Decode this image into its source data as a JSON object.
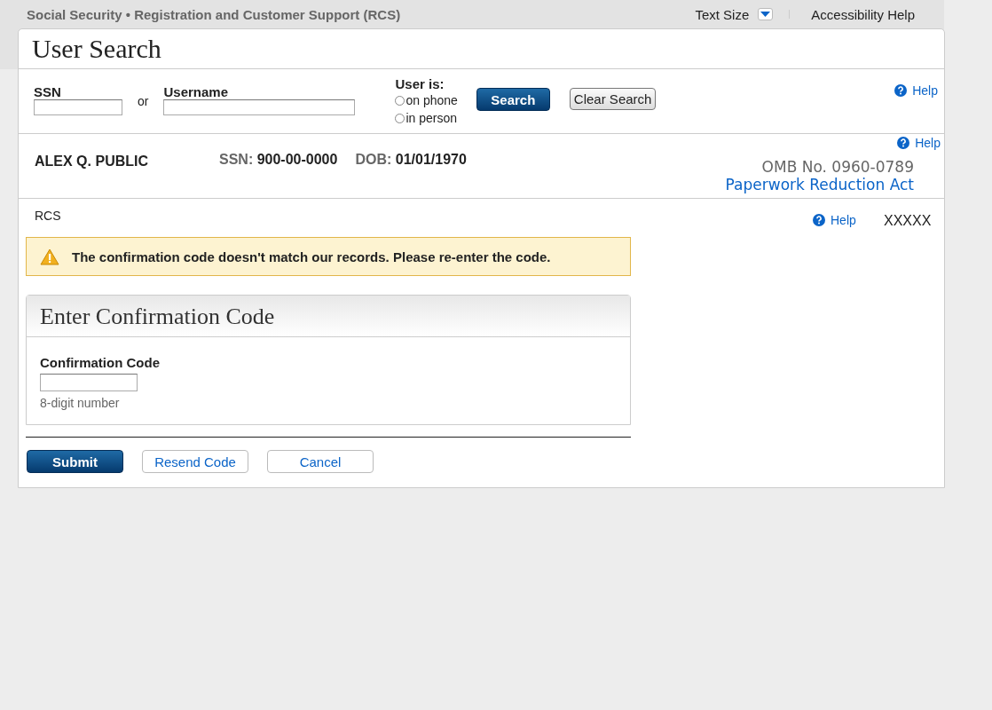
{
  "header": {
    "title": "Social Security • Registration and Customer Support (RCS)",
    "text_size_label": "Text Size",
    "accessibility_link": "Accessibility Help"
  },
  "page_title": "User Search",
  "search": {
    "ssn_label": "SSN",
    "or_text": "or",
    "username_label": "Username",
    "user_is_label": "User is:",
    "user_is_options": [
      {
        "label": "on phone",
        "selected": false
      },
      {
        "label": "in person",
        "selected": false
      }
    ],
    "buttons": [
      {
        "label": "Search",
        "kind": "primary"
      },
      {
        "label": "Clear Search",
        "kind": "system"
      }
    ],
    "help": "Help"
  },
  "person": {
    "name": "ALEX Q. PUBLIC",
    "fields": [
      {
        "label": "SSN:",
        "value": "900-00-0000"
      },
      {
        "label": "DOB:",
        "value": "01/01/1970"
      }
    ],
    "help": "Help",
    "omb": "OMB No. 0960-0789",
    "paperwork_link": "Paperwork Reduction Act"
  },
  "section": {
    "breadcrumb": "RCS",
    "help": "Help",
    "code": "XXXXX"
  },
  "alert": {
    "kind": "warning",
    "message": "The confirmation code doesn't match our records. Please re-enter the code."
  },
  "panel": {
    "title": "Enter Confirmation Code",
    "field_label": "Confirmation Code",
    "hint": "8-digit number"
  },
  "actions": [
    {
      "label": "Submit",
      "kind": "primary"
    },
    {
      "label": "Resend Code",
      "kind": "secondary"
    },
    {
      "label": "Cancel",
      "kind": "secondary"
    }
  ]
}
